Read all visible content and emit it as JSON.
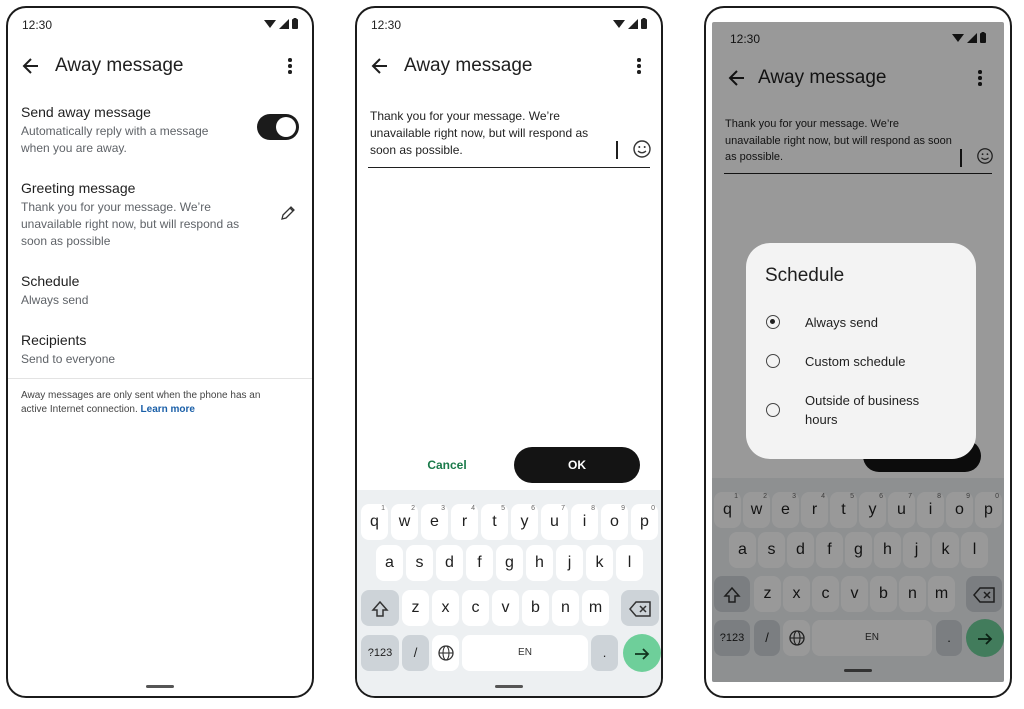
{
  "status": {
    "time": "12:30"
  },
  "screen1": {
    "title": "Away message",
    "settings": [
      {
        "label": "Send away message",
        "value": "Automatically reply with a message when you are away."
      },
      {
        "label": "Greeting message",
        "value": "Thank you for your message. We’re unavailable right now, but will respond as soon as possible"
      },
      {
        "label": "Schedule",
        "value": "Always send"
      },
      {
        "label": "Recipients",
        "value": "Send to everyone"
      }
    ],
    "toggle_on": true,
    "note": "Away messages are only sent when the phone has an active Internet connection.",
    "learn_more": "Learn more"
  },
  "screen2": {
    "title": "Away message",
    "message": "Thank you for your message. We’re unavailable right now, but will respond as soon as possible.",
    "cancel_label": "Cancel",
    "ok_label": "OK"
  },
  "keyboard": {
    "row1": [
      {
        "key": "q",
        "hint": "1"
      },
      {
        "key": "w",
        "hint": "2"
      },
      {
        "key": "e",
        "hint": "3"
      },
      {
        "key": "r",
        "hint": "4"
      },
      {
        "key": "t",
        "hint": "5"
      },
      {
        "key": "y",
        "hint": "6"
      },
      {
        "key": "u",
        "hint": "7"
      },
      {
        "key": "i",
        "hint": "8"
      },
      {
        "key": "o",
        "hint": "9"
      },
      {
        "key": "p",
        "hint": "0"
      }
    ],
    "row2": [
      "a",
      "s",
      "d",
      "f",
      "g",
      "h",
      "j",
      "k",
      "l"
    ],
    "row3": [
      "z",
      "x",
      "c",
      "v",
      "b",
      "n",
      "m"
    ],
    "symbols_label": "?123",
    "slash": "/",
    "space_label": "EN",
    "period": "."
  },
  "screen3": {
    "title": "Away message",
    "message": "Thank you for your message. We’re unavailable right now, but will respond as soon as possible.",
    "dialog": {
      "title": "Schedule",
      "options": [
        "Always send",
        "Custom schedule",
        "Outside of business hours"
      ],
      "selected": "Always send"
    }
  },
  "icons": {
    "back": "arrow-left-icon",
    "more": "more-vert-icon",
    "edit": "pencil-icon",
    "emoji": "emoji-icon",
    "shift": "shift-icon",
    "backspace": "backspace-icon",
    "globe": "globe-icon",
    "enter": "arrow-right-icon"
  },
  "colors": {
    "toggle": "#1b1b1b",
    "ok_button": "#141414",
    "cancel_text": "#1a7a4a",
    "enter_key": "#6ecf9a",
    "link": "#1a5fa8"
  }
}
